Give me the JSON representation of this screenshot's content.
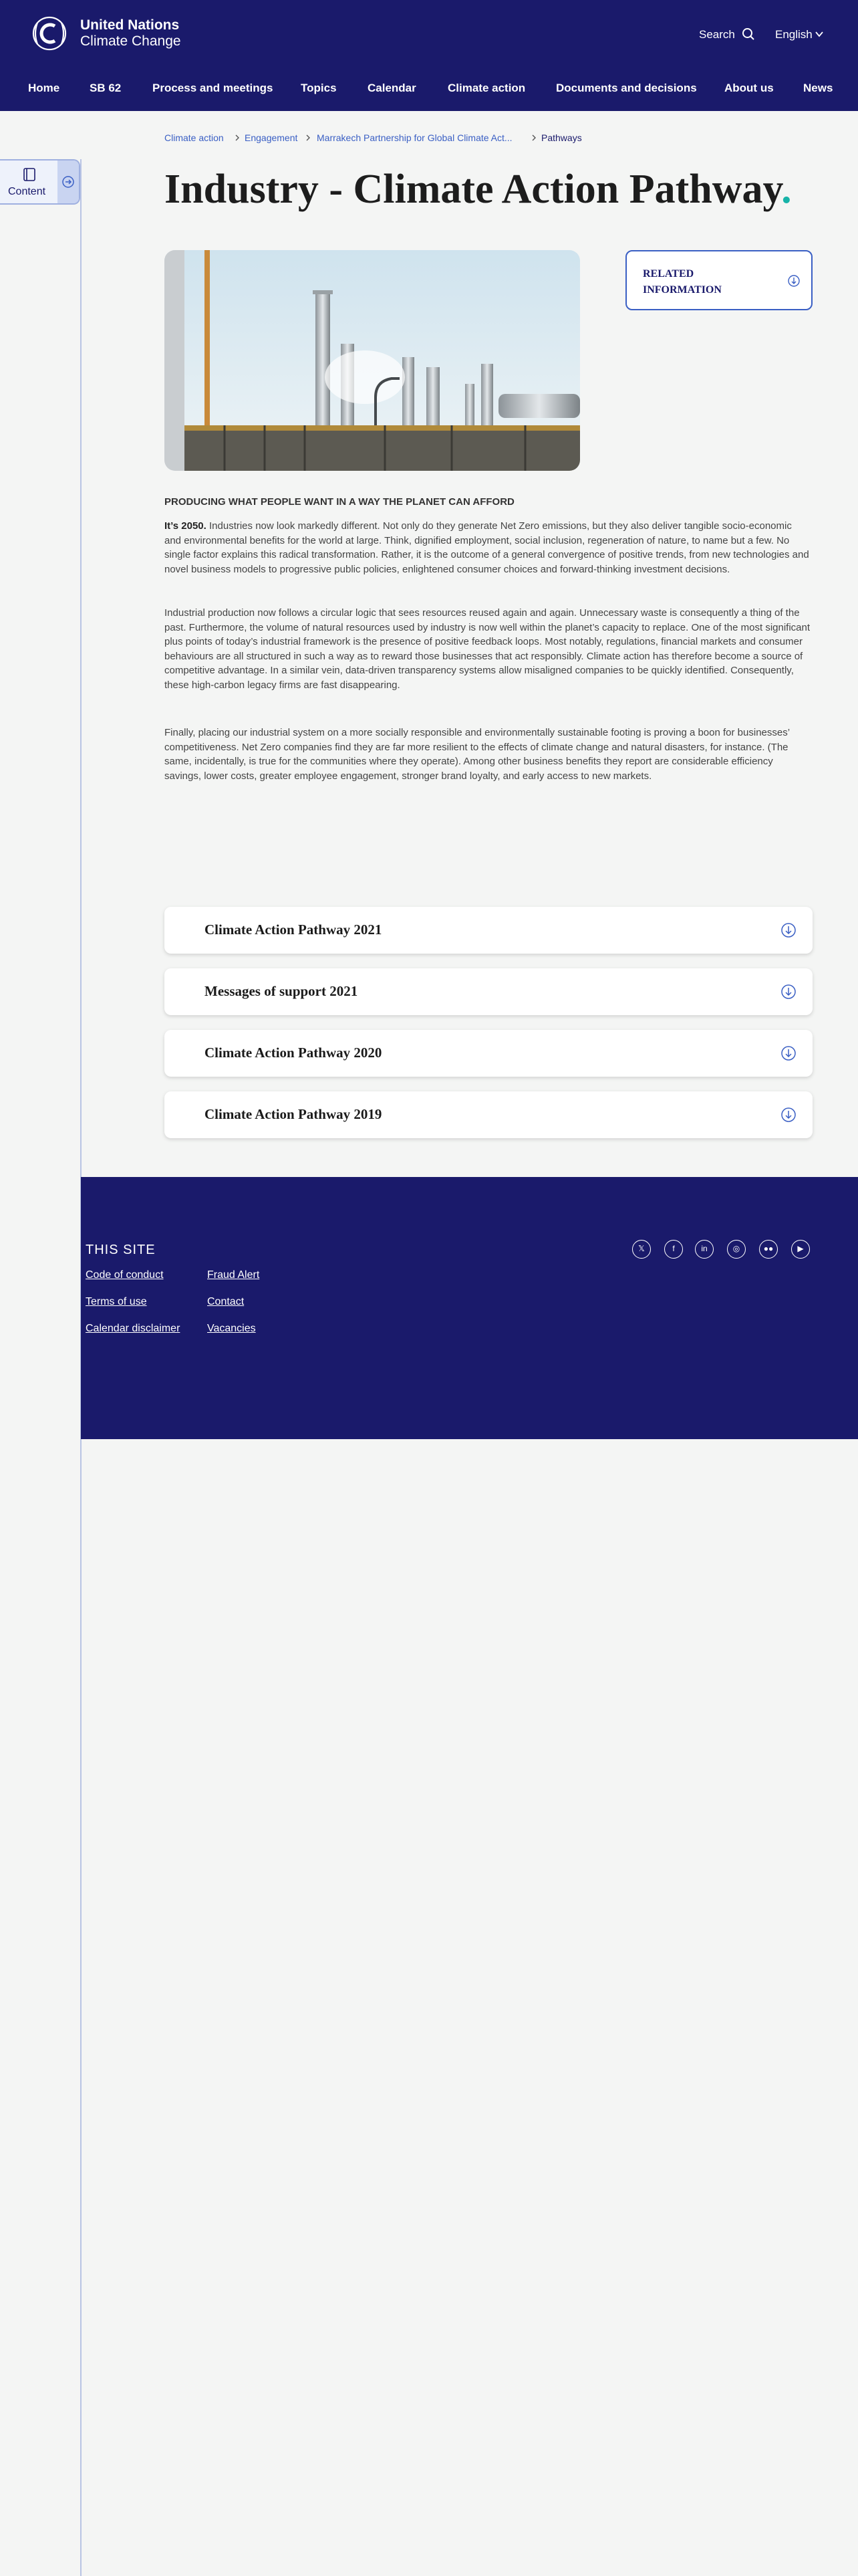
{
  "header": {
    "org_line1": "United Nations",
    "org_line2": "Climate Change",
    "search_label": "Search",
    "language": "English",
    "nav": [
      "Home",
      "SB 62",
      "Process and meetings",
      "Topics",
      "Calendar",
      "Climate action",
      "Documents and decisions",
      "About us",
      "News"
    ]
  },
  "sidebar": {
    "content_label": "Content"
  },
  "breadcrumb": [
    "Climate action",
    "Engagement",
    "Marrakech Partnership for Global Climate Act...",
    "Pathways"
  ],
  "page": {
    "title": "Industry - Climate Action Pathway",
    "title_dot": ".",
    "related_label": "RELATED INFORMATION",
    "kicker": "PRODUCING WHAT PEOPLE WANT IN A WAY THE PLANET CAN AFFORD",
    "p1_lead": "It’s 2050.",
    "p1": " Industries now look markedly different. Not only do they generate Net Zero emissions, but they also deliver tangible socio-economic and environmental benefits for the world at large. Think, dignified employment, social inclusion, regeneration of nature, to name but a few. No single factor explains this radical transformation. Rather, it is the outcome of a general convergence of positive trends, from new technologies and novel business models to progressive public policies, enlightened consumer choices and forward-thinking investment decisions.",
    "p2": "Industrial production now follows a circular logic that sees resources reused again and again. Unnecessary waste is consequently a thing of the past. Furthermore, the volume of natural resources used by industry is now well within the planet’s capacity to replace. One of the most significant plus points of today’s industrial framework is the presence of positive feedback loops. Most notably, regulations, financial markets and consumer behaviours are all structured in such a way as to reward those businesses that act responsibly. Climate action has therefore become a source of competitive advantage. In a similar vein, data-driven transparency systems allow misaligned companies to be quickly identified. Consequently, these high-carbon legacy firms are fast disappearing.",
    "p3": "Finally, placing our industrial system on a more socially responsible and environmentally sustainable footing is proving a boon for businesses’ competitiveness. Net Zero companies find they are far more resilient to the effects of climate change and natural disasters, for instance. (The same, incidentally, is true for the communities where they operate). Among other business benefits they report are considerable efficiency savings, lower costs, greater employee engagement, stronger brand loyalty, and early access to new markets."
  },
  "accordions": [
    "Climate Action Pathway 2021",
    "Messages of support 2021",
    "Climate Action Pathway 2020",
    "Climate Action Pathway 2019"
  ],
  "footer": {
    "heading": "THIS SITE",
    "links_col1": [
      "Code of conduct",
      "Terms of use",
      "Calendar disclaimer"
    ],
    "links_col2": [
      "Fraud Alert",
      "Contact",
      "Vacancies"
    ],
    "social_icons": [
      "x-icon",
      "facebook-icon",
      "linkedin-icon",
      "instagram-icon",
      "flickr-icon",
      "youtube-icon"
    ]
  },
  "colors": {
    "brand_navy": "#1a1a6b",
    "link_blue": "#3a5fc4",
    "accent_teal": "#17b3a8"
  }
}
